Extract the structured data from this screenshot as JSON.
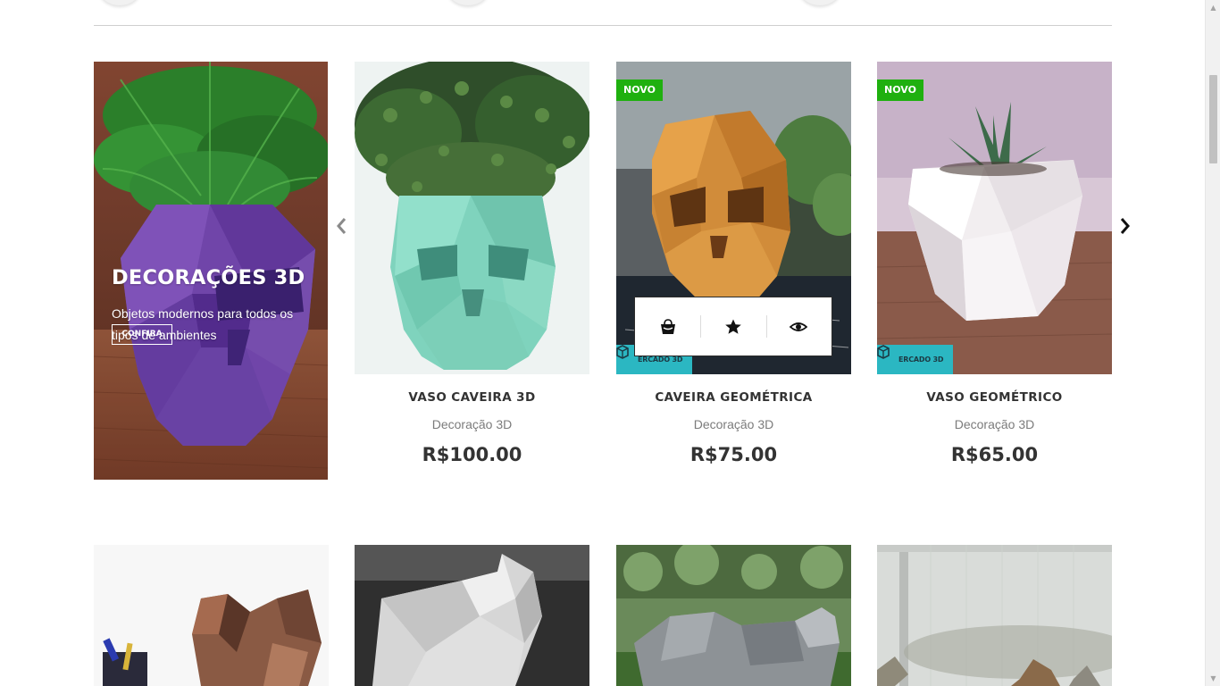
{
  "banner": {
    "title": "DECORAÇÕES 3D",
    "subtitle": "Objetos modernos para todos os tipos de ambientes",
    "button_label": "CONFIRA"
  },
  "carousel": {
    "prev_icon": "chevron-left-icon",
    "next_icon": "chevron-right-icon"
  },
  "products": [
    {
      "name": "VASO CAVEIRA 3D",
      "category": "Decoração 3D",
      "price": "R$100.00",
      "badge": "",
      "brand": ""
    },
    {
      "name": "CAVEIRA GEOMÉTRICA",
      "category": "Decoração 3D",
      "price": "R$75.00",
      "badge": "NOVO",
      "brand": "ERCADO 3D"
    },
    {
      "name": "VASO GEOMÉTRICO",
      "category": "Decoração 3D",
      "price": "R$65.00",
      "badge": "NOVO",
      "brand": "ERCADO 3D"
    }
  ],
  "product_actions": [
    {
      "icon": "shopping-bag-icon"
    },
    {
      "icon": "star-icon"
    },
    {
      "icon": "eye-icon"
    }
  ],
  "colors": {
    "badge_green": "#1fb00f",
    "brand_teal": "#2bb7c2",
    "text_dark": "#333333",
    "text_muted": "#7b7b7b"
  }
}
